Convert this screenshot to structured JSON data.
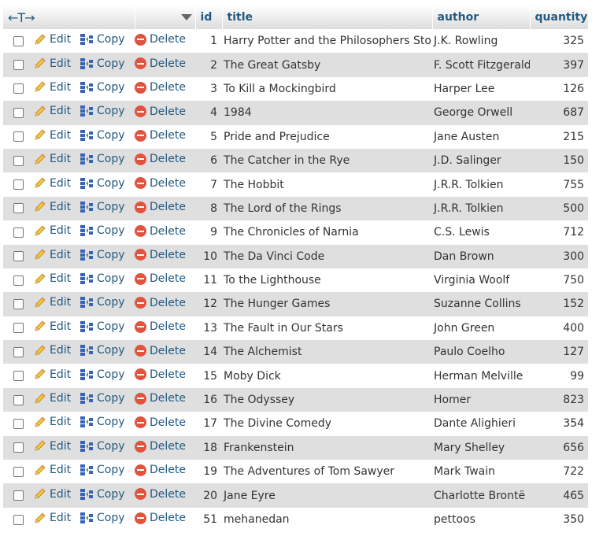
{
  "header": {
    "arrows": "←T→",
    "columns": {
      "id": "id",
      "title": "title",
      "author": "author",
      "quantity": "quantity"
    }
  },
  "actions": {
    "edit": "Edit",
    "copy": "Copy",
    "delete": "Delete"
  },
  "rows": [
    {
      "id": "1",
      "title": "Harry Potter and the Philosophers Stone",
      "author": "J.K. Rowling",
      "quantity": "325"
    },
    {
      "id": "2",
      "title": "The Great Gatsby",
      "author": "F. Scott Fitzgerald",
      "quantity": "397"
    },
    {
      "id": "3",
      "title": "To Kill a Mockingbird",
      "author": "Harper Lee",
      "quantity": "126"
    },
    {
      "id": "4",
      "title": "1984",
      "author": "George Orwell",
      "quantity": "687"
    },
    {
      "id": "5",
      "title": "Pride and Prejudice",
      "author": "Jane Austen",
      "quantity": "215"
    },
    {
      "id": "6",
      "title": "The Catcher in the Rye",
      "author": "J.D. Salinger",
      "quantity": "150"
    },
    {
      "id": "7",
      "title": "The Hobbit",
      "author": "J.R.R. Tolkien",
      "quantity": "755"
    },
    {
      "id": "8",
      "title": "The Lord of the Rings",
      "author": "J.R.R. Tolkien",
      "quantity": "500"
    },
    {
      "id": "9",
      "title": "The Chronicles of Narnia",
      "author": "C.S. Lewis",
      "quantity": "712"
    },
    {
      "id": "10",
      "title": "The Da Vinci Code",
      "author": "Dan Brown",
      "quantity": "300"
    },
    {
      "id": "11",
      "title": "To the Lighthouse",
      "author": "Virginia Woolf",
      "quantity": "750"
    },
    {
      "id": "12",
      "title": "The Hunger Games",
      "author": "Suzanne Collins",
      "quantity": "152"
    },
    {
      "id": "13",
      "title": "The Fault in Our Stars",
      "author": "John Green",
      "quantity": "400"
    },
    {
      "id": "14",
      "title": "The Alchemist",
      "author": "Paulo Coelho",
      "quantity": "127"
    },
    {
      "id": "15",
      "title": "Moby Dick",
      "author": "Herman Melville",
      "quantity": "99"
    },
    {
      "id": "16",
      "title": "The Odyssey",
      "author": "Homer",
      "quantity": "823"
    },
    {
      "id": "17",
      "title": "The Divine Comedy",
      "author": "Dante Alighieri",
      "quantity": "354"
    },
    {
      "id": "18",
      "title": "Frankenstein",
      "author": "Mary Shelley",
      "quantity": "656"
    },
    {
      "id": "19",
      "title": "The Adventures of Tom Sawyer",
      "author": "Mark Twain",
      "quantity": "722"
    },
    {
      "id": "20",
      "title": "Jane Eyre",
      "author": "Charlotte Brontë",
      "quantity": "465"
    },
    {
      "id": "51",
      "title": "mehanedan",
      "author": "pettoos",
      "quantity": "350"
    }
  ],
  "colors": {
    "link": "#235a81",
    "row_alt": "#dfdfdf",
    "delete_icon": "#e2533f"
  }
}
